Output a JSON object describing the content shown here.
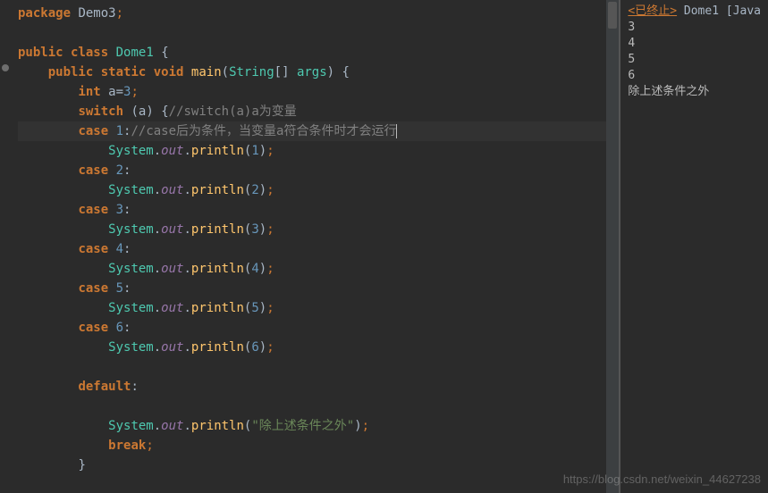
{
  "code": {
    "l1_package": "package",
    "l1_pkg": "Demo3",
    "l3_public": "public",
    "l3_class": "class",
    "l3_name": "Dome1",
    "l4_public": "public",
    "l4_static": "static",
    "l4_void": "void",
    "l4_main": "main",
    "l4_string": "String",
    "l4_args": "args",
    "l5_int": "int",
    "l5_var": "a",
    "l5_val": "3",
    "l6_switch": "switch",
    "l6_var": "a",
    "l6_comment": "//switch(a)a为变量",
    "l7_case": "case",
    "l7_val": "1",
    "l7_comment": "//case后为条件，当变量a符合条件时才会运行",
    "l8_sys": "System",
    "l8_out": "out",
    "l8_println": "println",
    "l8_arg": "1",
    "l9_case": "case",
    "l9_val": "2",
    "l10_sys": "System",
    "l10_out": "out",
    "l10_println": "println",
    "l10_arg": "2",
    "l11_case": "case",
    "l11_val": "3",
    "l12_sys": "System",
    "l12_out": "out",
    "l12_println": "println",
    "l12_arg": "3",
    "l13_case": "case",
    "l13_val": "4",
    "l14_sys": "System",
    "l14_out": "out",
    "l14_println": "println",
    "l14_arg": "4",
    "l15_case": "case",
    "l15_val": "5",
    "l16_sys": "System",
    "l16_out": "out",
    "l16_println": "println",
    "l16_arg": "5",
    "l17_case": "case",
    "l17_val": "6",
    "l18_sys": "System",
    "l18_out": "out",
    "l18_println": "println",
    "l18_arg": "6",
    "l20_default": "default",
    "l22_sys": "System",
    "l22_out": "out",
    "l22_println": "println",
    "l22_arg": "\"除上述条件之外\"",
    "l23_break": "break"
  },
  "output": {
    "header_status": "<已终止>",
    "header_class": " Dome1 [Java",
    "lines": [
      "3",
      "4",
      "5",
      "6",
      "除上述条件之外"
    ]
  },
  "watermark": "https://blog.csdn.net/weixin_44627238"
}
